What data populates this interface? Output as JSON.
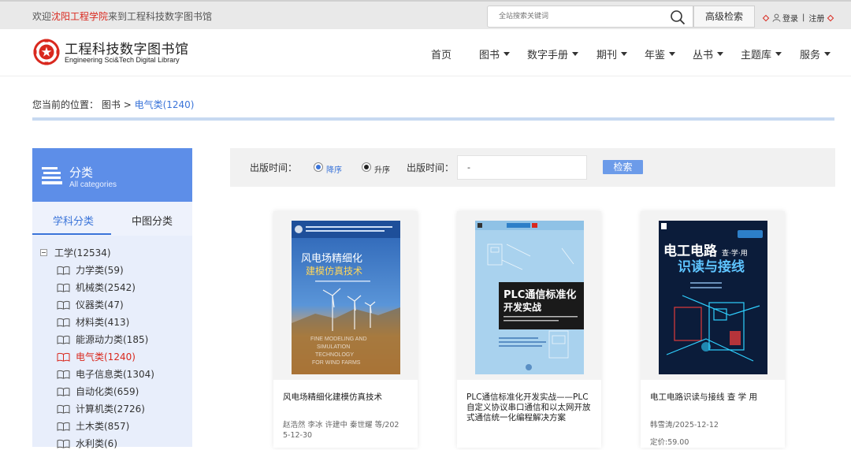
{
  "topbar": {
    "welcome_prefix": "欢迎",
    "school": "沈阳工程学院",
    "welcome_suffix": "来到工程科技数字图书馆",
    "search_placeholder": "全站搜索关键词",
    "advanced_search": "高级检索",
    "login": "登录",
    "separator": "|",
    "register": "注册"
  },
  "header": {
    "logo_cn": "工程科技数字图书馆",
    "logo_en": "Engineering Sci&Tech Digital Library",
    "nav": [
      "首页",
      "图书",
      "数字手册",
      "期刊",
      "年鉴",
      "丛书",
      "主题库",
      "服务"
    ]
  },
  "breadcrumb": {
    "prefix": "您当前的位置：",
    "level1": "图书",
    "sep": ">",
    "current": "电气类(1240)"
  },
  "sidebar": {
    "title": "分类",
    "subtitle": "All categories",
    "tabs": [
      "学科分类",
      "中图分类"
    ],
    "root": "工学(12534)",
    "items": [
      "力学类(59)",
      "机械类(2542)",
      "仪器类(47)",
      "材料类(413)",
      "能源动力类(185)",
      "电气类(1240)",
      "电子信息类(1304)",
      "自动化类(659)",
      "计算机类(2726)",
      "土木类(857)",
      "水利类(6)"
    ]
  },
  "filter": {
    "pub_time_label": "出版时间：",
    "desc": "降序",
    "asc": "升序",
    "range_label": "出版时间：",
    "range_value": "-",
    "search_button": "检索"
  },
  "books": [
    {
      "title": "风电场精细化建模仿真技术",
      "meta1": "赵浩然 李冰 许建中 秦世耀 等/202",
      "meta2": "5-12-30",
      "cover_title1": "风电场精细化",
      "cover_title2": "建模仿真技术",
      "cover_en1": "FINE MODELING AND",
      "cover_en2": "SIMULATION",
      "cover_en3": "TECHNOLOGY",
      "cover_en4": "FOR WIND FARMS"
    },
    {
      "title": "PLC通信标准化开发实战——PLC自定义协议串口通信和以太网开放式通信统一化编程解决方案",
      "cover_title1": "PLC通信标准化",
      "cover_title2": "开发实战"
    },
    {
      "title": "电工电路识读与接线 查 学 用",
      "meta1": "韩雪涛/2025-12-12",
      "meta2": "定价:59.00",
      "cover_title1": "电工电路",
      "cover_title2": "识读与接线",
      "cover_badge": "查·学·用"
    }
  ],
  "colors": {
    "accent": "#3a74d9",
    "brand_red": "#d9281e",
    "sidebar_head": "#5d8ee8"
  }
}
